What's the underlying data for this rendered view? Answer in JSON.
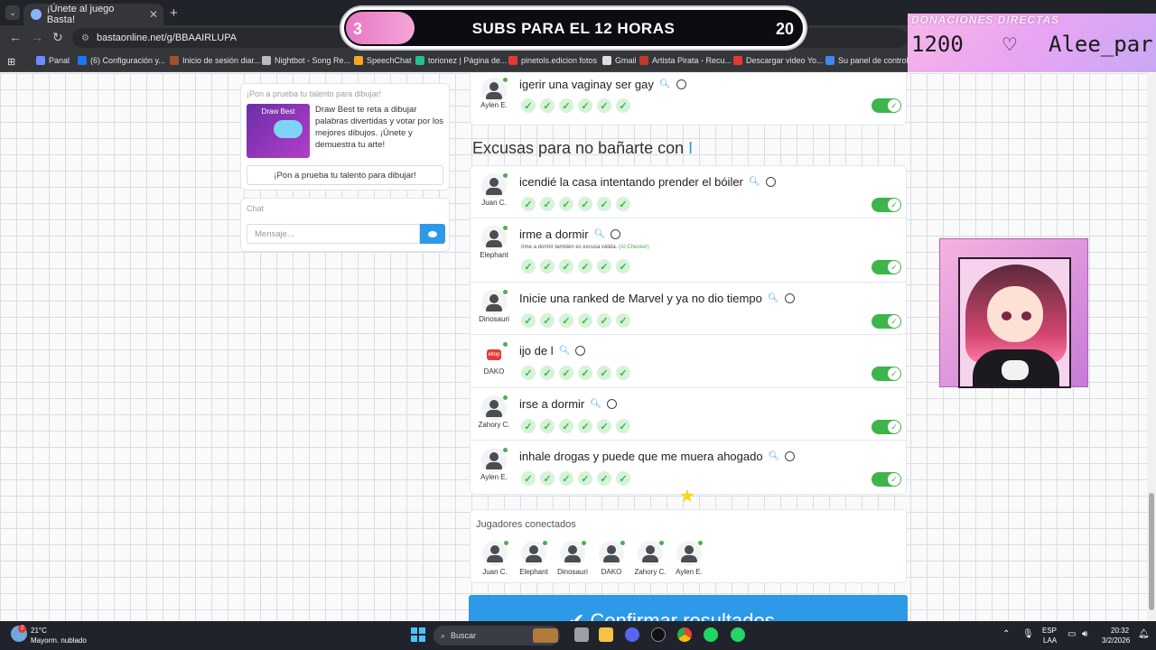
{
  "browser": {
    "tab_title": "¡Únete al juego Basta!",
    "url": "bastaonline.net/g/BBAAIRLUPA",
    "bookmarks": [
      {
        "label": "Panal",
        "color": "#6b8cff"
      },
      {
        "label": "(6) Configuración y...",
        "color": "#1877f2"
      },
      {
        "label": "Inicio de sesión diar...",
        "color": "#a0522d"
      },
      {
        "label": "Nightbot - Song Re...",
        "color": "#bbbbbb"
      },
      {
        "label": "SpeechChat",
        "color": "#f5a623"
      },
      {
        "label": "torionez | Página de...",
        "color": "#27c08a"
      },
      {
        "label": "pinetols.edicion fotos",
        "color": "#e53935"
      },
      {
        "label": "Gmail",
        "color": "#dddddd"
      },
      {
        "label": "Artista Pirata - Recu...",
        "color": "#c0392b"
      },
      {
        "label": "Descargar video Yo...",
        "color": "#e53935"
      },
      {
        "label": "Su panel de control...",
        "color": "#4285f4"
      }
    ]
  },
  "sidebar": {
    "promo": {
      "title": "¡Pon a prueba tu talento para dibujar!",
      "image_caption": "Draw Best",
      "description": "Draw Best te reta a dibujar palabras divertidas y votar por los mejores dibujos. ¡Únete y demuestra tu arte!",
      "button": "¡Pon a prueba tu talento para dibujar!"
    },
    "chat": {
      "title": "Chat",
      "placeholder": "Mensaje..."
    }
  },
  "game": {
    "top_answer": {
      "player": "Aylen E.",
      "text": "igerir una vaginay ser gay"
    },
    "category_title": "Excusas para no bañarte con",
    "category_letter": "I",
    "answers": [
      {
        "player": "Juan C.",
        "text": "icendié la casa intentando prender el bóiler",
        "note": ""
      },
      {
        "player": "Elephant",
        "text": "irme a dormir",
        "note": "Irme a dormir también es excusa válida.",
        "note_tag": "(AI Checker)"
      },
      {
        "player": "Dinosauri",
        "text": "Inicie una ranked de Marvel y ya no dio tiempo",
        "note": ""
      },
      {
        "player": "DAKO",
        "text": "ijo de l",
        "note": ""
      },
      {
        "player": "Zahory C.",
        "text": "irse a dormir",
        "note": ""
      },
      {
        "player": "Aylen E.",
        "text": "inhale drogas y puede que me muera ahogado",
        "note": ""
      }
    ],
    "players_title": "Jugadores conectados",
    "players": [
      "Juan C.",
      "Elephant",
      "Dinosauri",
      "DAKO",
      "Zahory C.",
      "Aylen E."
    ],
    "dako_badge": "eltop",
    "confirm_button": "✔ Confirmar resultados"
  },
  "overlay": {
    "subs_current": "3",
    "subs_title": "SUBS PARA EL 12 HORAS",
    "subs_goal": "20",
    "subs_progress": 0.15,
    "donations_title": "DONACIONES DIRECTAS",
    "donation_amount": "1200",
    "donation_heart": "♡",
    "donation_name": "Alee_parr"
  },
  "taskbar": {
    "temperature": "21°C",
    "weather": "Mayorm. nublado",
    "search": "Buscar",
    "lang1": "ESP",
    "lang2": "LAA",
    "time": "20:32",
    "date": "3/2/2026",
    "weather_badge": "2"
  }
}
